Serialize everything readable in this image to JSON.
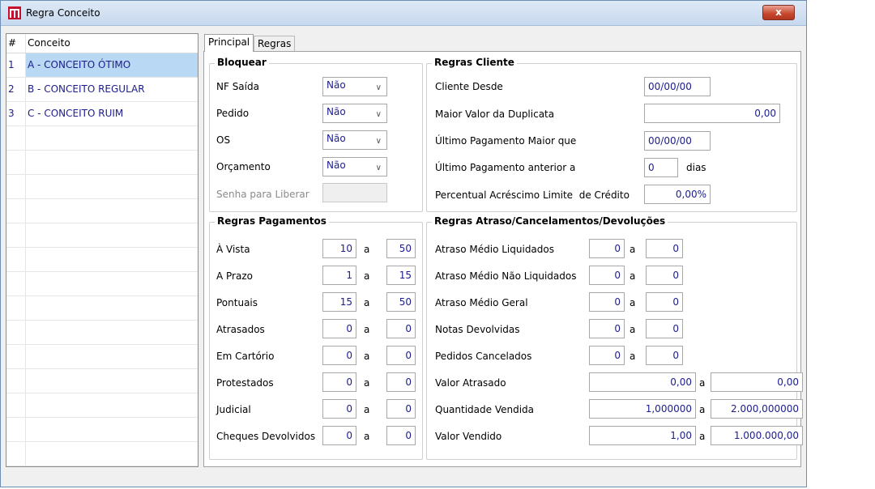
{
  "window": {
    "title": "Regra Conceito",
    "close_label": "x"
  },
  "grid": {
    "headers": {
      "num": "#",
      "conceito": "Conceito"
    },
    "rows": [
      {
        "num": "1",
        "conceito": "A - CONCEITO ÓTIMO"
      },
      {
        "num": "2",
        "conceito": "B - CONCEITO REGULAR"
      },
      {
        "num": "3",
        "conceito": "C - CONCEITO RUIM"
      }
    ]
  },
  "tabs": {
    "principal": "Principal",
    "regras": "Regras"
  },
  "bloquear": {
    "title": "Bloquear",
    "nf_saida": {
      "label": "NF Saída",
      "value": "Não"
    },
    "pedido": {
      "label": "Pedido",
      "value": "Não"
    },
    "os": {
      "label": "OS",
      "value": "Não"
    },
    "orcamento": {
      "label": "Orçamento",
      "value": "Não"
    },
    "senha": {
      "label": "Senha para Liberar",
      "value": ""
    }
  },
  "regras_cliente": {
    "title": "Regras Cliente",
    "cliente_desde": {
      "label": "Cliente Desde",
      "value": "00/00/00"
    },
    "maior_valor": {
      "label": "Maior Valor da Duplicata",
      "value": "0,00"
    },
    "ult_pag_maior": {
      "label": "Último Pagamento Maior que",
      "value": "00/00/00"
    },
    "ult_pag_anterior": {
      "label": "Último Pagamento anterior a",
      "value": "0",
      "unit": "dias"
    },
    "percentual": {
      "label": "Percentual Acréscimo Limite  de Crédito",
      "value": "0,00%"
    }
  },
  "regras_pagamentos": {
    "title": "Regras Pagamentos",
    "sep": "a",
    "rows": [
      {
        "label": "À Vista",
        "from": "10",
        "to": "50"
      },
      {
        "label": "A Prazo",
        "from": "1",
        "to": "15"
      },
      {
        "label": "Pontuais",
        "from": "15",
        "to": "50"
      },
      {
        "label": "Atrasados",
        "from": "0",
        "to": "0"
      },
      {
        "label": "Em Cartório",
        "from": "0",
        "to": "0"
      },
      {
        "label": "Protestados",
        "from": "0",
        "to": "0"
      },
      {
        "label": "Judicial",
        "from": "0",
        "to": "0"
      },
      {
        "label": "Cheques Devolvidos",
        "from": "0",
        "to": "0"
      }
    ]
  },
  "regras_atraso": {
    "title": "Regras Atraso/Cancelamentos/Devoluções",
    "sep": "a",
    "rows": [
      {
        "label": "Atraso Médio Liquidados",
        "from": "0",
        "to": "0"
      },
      {
        "label": "Atraso Médio Não Liquidados",
        "from": "0",
        "to": "0"
      },
      {
        "label": "Atraso Médio Geral",
        "from": "0",
        "to": "0"
      },
      {
        "label": "Notas Devolvidas",
        "from": "0",
        "to": "0"
      },
      {
        "label": "Pedidos Cancelados",
        "from": "0",
        "to": "0"
      },
      {
        "label": "Valor Atrasado",
        "from": "0,00",
        "to": "0,00"
      },
      {
        "label": "Quantidade Vendida",
        "from": "1,000000",
        "to": "2.000,000000"
      },
      {
        "label": "Valor Vendido",
        "from": "1,00",
        "to": "1.000.000,00"
      }
    ]
  }
}
